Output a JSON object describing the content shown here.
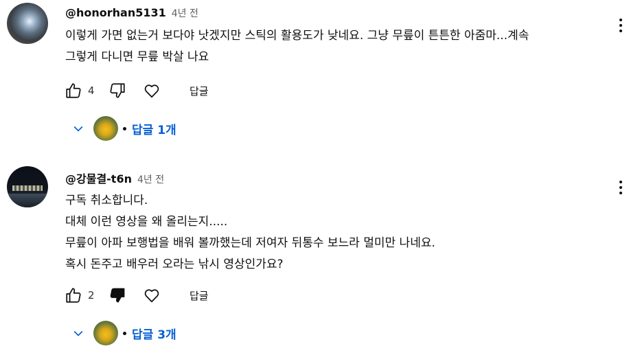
{
  "comments": [
    {
      "author": "@honorhan5131",
      "time": "4년 전",
      "lines": [
        "이렇게 가면 없는거 보다야 낫겠지만 스틱의 활용도가 낮네요. 그냥 무릎이 튼튼한 아줌마...계속",
        "그렇게 다니면 무릎 박살 나요"
      ],
      "likes": "4",
      "reply_label": "답글",
      "replies_label": "답글 1개",
      "disliked": false
    },
    {
      "author": "@강물결-t6n",
      "time": "4년 전",
      "lines": [
        "구독 취소합니다.",
        "대체 이런 영상을 왜 올리는지.....",
        "무릎이 아파 보행법을 배워 볼까했는데 저여자 뒤통수 보느라 멀미만 나네요.",
        "혹시 돈주고 배우러 오라는 낚시 영상인가요?"
      ],
      "likes": "2",
      "reply_label": "답글",
      "replies_label": "답글 3개",
      "disliked": true
    }
  ],
  "icons": {
    "like": "thumbs-up-icon",
    "dislike": "thumbs-down-icon",
    "heart": "heart-icon",
    "expand": "chevron-down-icon",
    "menu": "more-vert-icon"
  },
  "colors": {
    "link": "#065fd4",
    "text": "#0f0f0f",
    "muted": "#606060"
  }
}
